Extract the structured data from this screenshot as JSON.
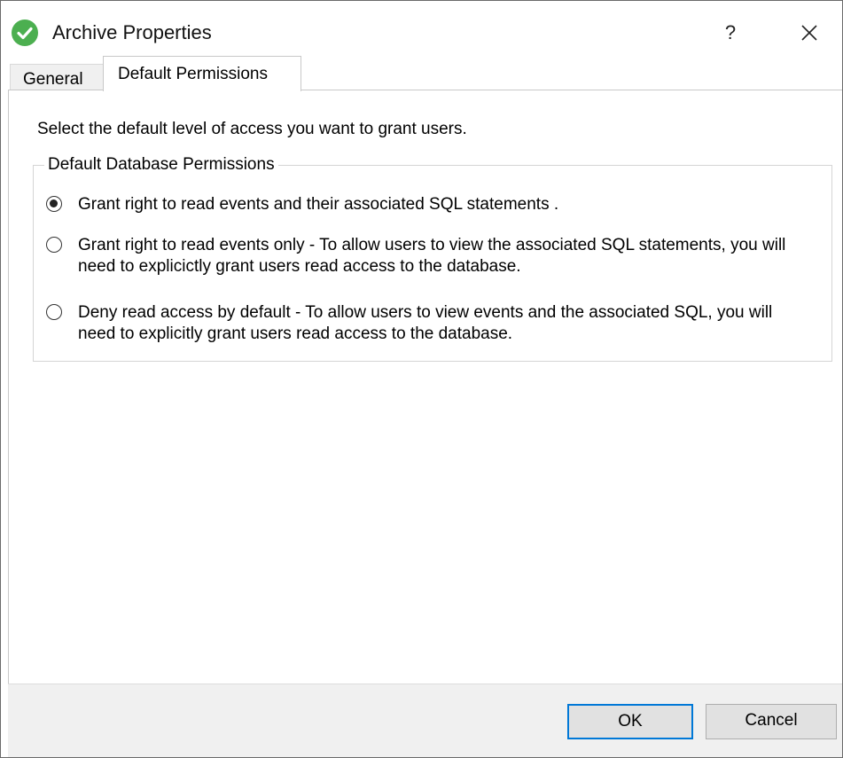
{
  "window": {
    "title": "Archive Properties",
    "help_label": "?",
    "accent_color": "#0078d7",
    "icon_color": "#4caf50"
  },
  "tabs": [
    {
      "label": "General",
      "selected": false
    },
    {
      "label": "Default Permissions",
      "selected": true
    }
  ],
  "page": {
    "intro": "Select the default level of access you want to grant users.",
    "group_title": "Default Database Permissions",
    "options": [
      {
        "label": "Grant right to read events and their associated SQL statements .",
        "checked": true
      },
      {
        "label": "Grant right to read events only - To allow users to view the associated SQL statements, you will need to explicictly grant users read access to the database.",
        "checked": false
      },
      {
        "label": "Deny read access by default - To allow users to view events and the associated SQL, you will need to explicitly grant users read access to the database.",
        "checked": false
      }
    ]
  },
  "footer": {
    "ok_label": "OK",
    "cancel_label": "Cancel"
  }
}
